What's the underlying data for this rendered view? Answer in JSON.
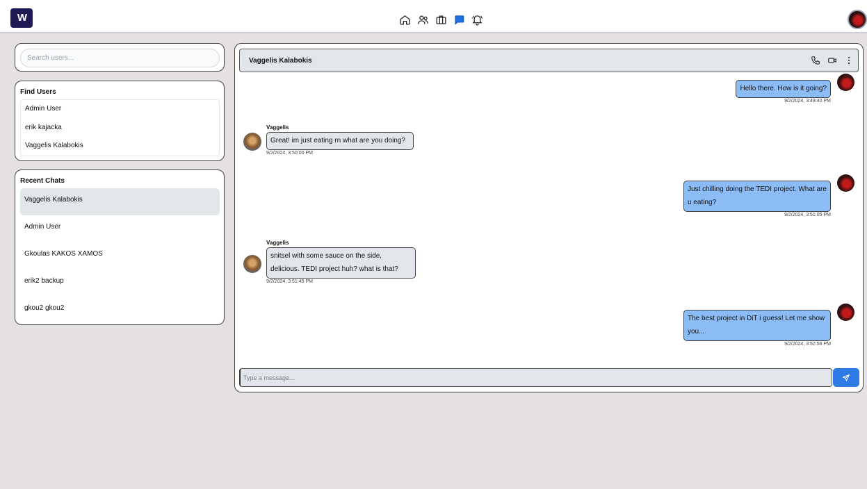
{
  "app": {
    "logo_text": "W",
    "brand_color": "#1d1a55",
    "accent": "#2f7be5"
  },
  "nav": {
    "icons": [
      "home-icon",
      "people-icon",
      "briefcase-icon",
      "chat-icon",
      "bell-icon"
    ],
    "active": "chat-icon"
  },
  "search": {
    "placeholder": "Search users..."
  },
  "find_users": {
    "title": "Find Users",
    "items": [
      "Admin User",
      "erik kajacka",
      "Vaggelis Kalabokis"
    ]
  },
  "recent_chats": {
    "title": "Recent Chats",
    "items": [
      "Vaggelis Kalabokis",
      "Admin User",
      "Gkoulas KAKOS XAMOS",
      "erik2 backup",
      "gkou2 gkou2"
    ],
    "active_index": 0
  },
  "chat": {
    "contact_name": "Vaggelis Kalabokis",
    "header_icons": [
      "phone-icon",
      "video-icon",
      "more-vertical-icon"
    ],
    "messages": [
      {
        "direction": "outgoing",
        "text": "Hello there. How is it going?",
        "timestamp": "9/2/2024, 3:49:40 PM"
      },
      {
        "direction": "incoming",
        "sender": "Vaggelis",
        "text": "Great! im just eating rn what are you doing?",
        "timestamp": "9/2/2024, 3:50:00 PM"
      },
      {
        "direction": "outgoing",
        "text": "Just chilling doing the TEDI project. What are u eating?",
        "timestamp": "9/2/2024, 3:51:05 PM"
      },
      {
        "direction": "incoming",
        "sender": "Vaggelis",
        "text": "snitsel with some sauce on the side, delicious. TEDI project huh? what is that?",
        "timestamp": "9/2/2024, 3:51:45 PM"
      },
      {
        "direction": "outgoing",
        "text": "The best project in DiT i guess! Let me show you...",
        "timestamp": "9/2/2024, 3:52:56 PM"
      }
    ],
    "composer_placeholder": "Type a message...",
    "send_icon": "send-icon"
  }
}
